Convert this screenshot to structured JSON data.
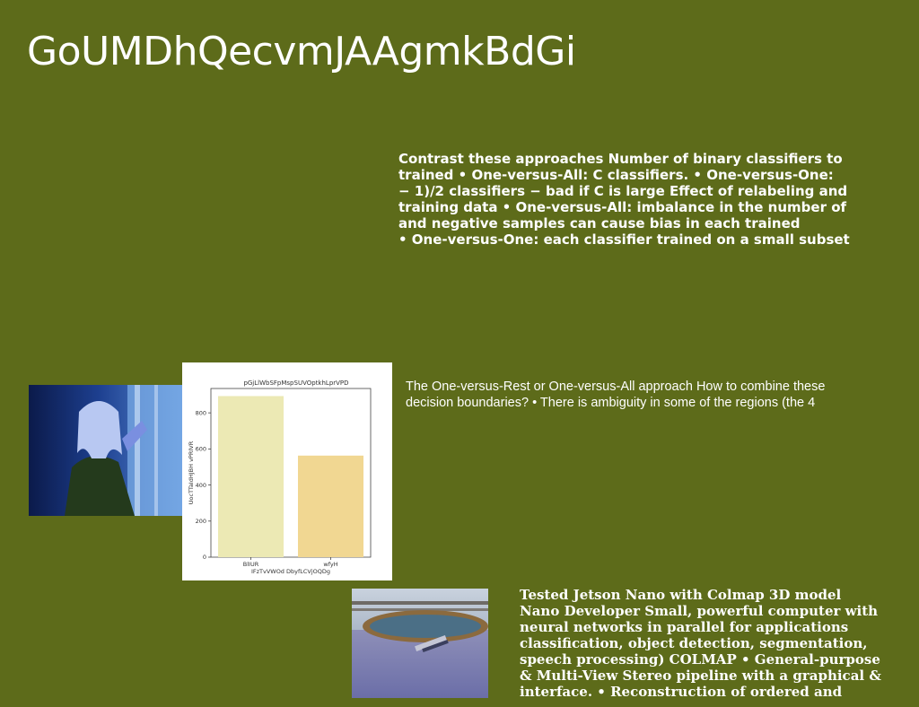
{
  "slide": {
    "title": "GoUMDhQecvmJAAgmkBdGi",
    "block_a_lines": [
      "Contrast these approaches Number of binary classifiers to",
      "trained • One-versus-All: C classifiers. • One-versus-One:",
      "− 1)/2 classifiers − bad if C is large Effect of relabeling and",
      "training data • One-versus-All: imbalance in the number of",
      "and negative samples can cause bias in each trained",
      "• One-versus-One: each classifier trained on a small subset"
    ],
    "block_b_lines": [
      "The One-versus-Rest or One-versus-All approach How to combine these",
      "decision boundaries? • There is ambiguity in some of the regions (the 4"
    ],
    "block_c_lines": [
      "Tested Jetson Nano with Colmap 3D model",
      "Nano Developer Small, powerful computer with",
      "neural networks in parallel for applications",
      "classification, object detection, segmentation,",
      "speech processing) COLMAP • General-purpose",
      "& Multi-View Stereo pipeline with a graphical &",
      "interface. • Reconstruction of ordered and"
    ]
  },
  "colors": {
    "background": "#5d6b1a",
    "text": "#ffffff",
    "bar_1": "#ece9b4",
    "bar_2": "#f1d792"
  },
  "chart_data": {
    "type": "bar",
    "title": "pGjLlWbSFpMspSUVOptkhLprVPD",
    "xlabel": "IFzTvVWOd DbyfLCVjOQDg",
    "ylabel": "UocTTaIdHJBH vPRIVR",
    "categories": [
      "BlIUR",
      "wfyH"
    ],
    "values": [
      893,
      563
    ],
    "ylim": [
      0,
      935
    ],
    "yticks": [
      0,
      200,
      400,
      600,
      800
    ],
    "grid": false
  }
}
